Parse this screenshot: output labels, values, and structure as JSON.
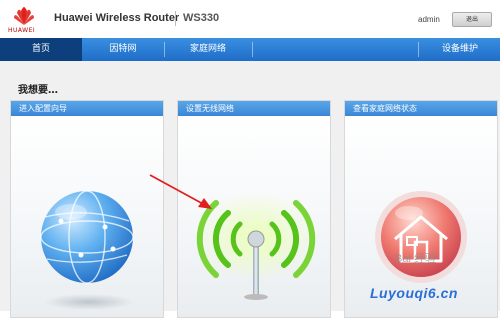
{
  "header": {
    "brand": "HUAWEI",
    "title": "Huawei Wireless Router",
    "model": "WS330",
    "user": "admin",
    "logout_label": "退出"
  },
  "nav": {
    "items": [
      {
        "label": "首页"
      },
      {
        "label": "因特网"
      },
      {
        "label": "家庭网络"
      },
      {
        "label": "设备维护"
      }
    ]
  },
  "main": {
    "heading": "我想要…",
    "cards": [
      {
        "title": "进入配置向导",
        "icon": "globe-icon"
      },
      {
        "title": "设置无线网络",
        "icon": "wifi-antenna-icon"
      },
      {
        "title": "查看家庭网络状态",
        "icon": "home-network-icon"
      }
    ]
  },
  "overlays": {
    "arrow": "red-pointer-arrow",
    "watermark": "Luyouqi6.cn",
    "baidu": "Bai 经验"
  },
  "colors": {
    "nav_bg": "#1f6dc9",
    "nav_active": "#0e3f7d",
    "card_header": "#4896e0",
    "brand_red": "#e02020",
    "watermark_blue": "#2a6fd6"
  }
}
